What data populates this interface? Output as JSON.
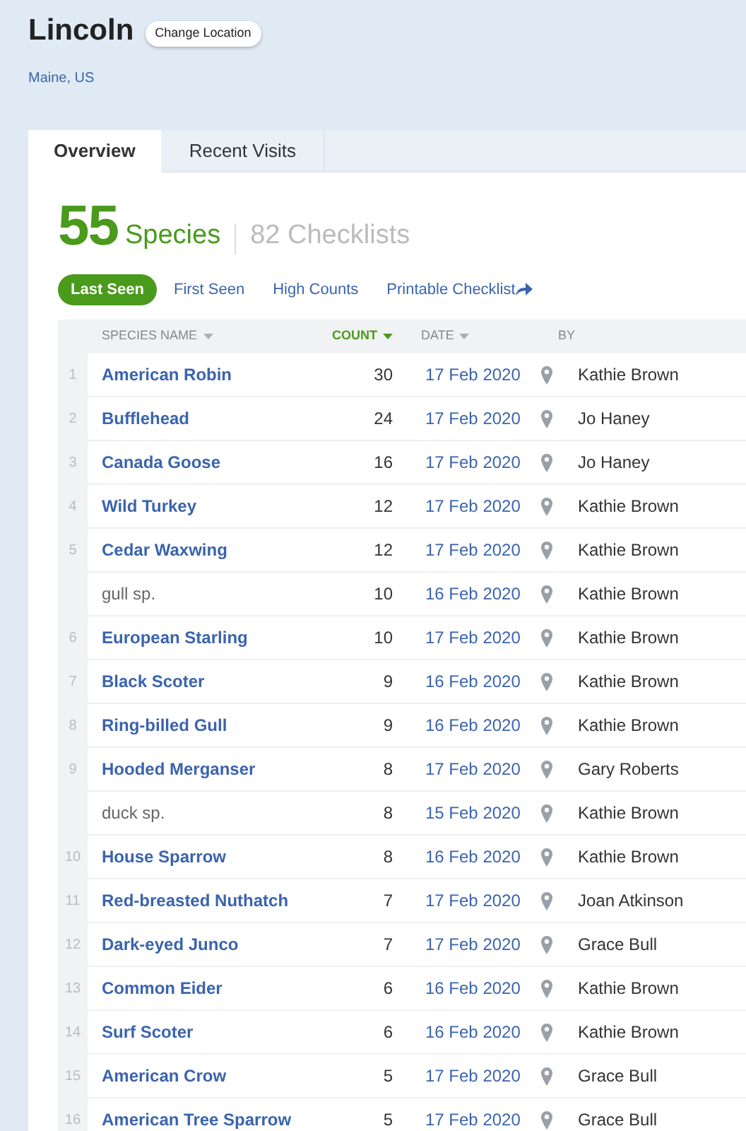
{
  "location": {
    "name": "Lincoln",
    "change_button": "Change Location",
    "region": "Maine, US"
  },
  "tabs": [
    {
      "label": "Overview",
      "selected": true
    },
    {
      "label": "Recent Visits",
      "selected": false
    }
  ],
  "summary": {
    "species_count": "55",
    "species_label": "Species",
    "checklists": "82 Checklists"
  },
  "filters": [
    {
      "label": "Last Seen",
      "selected": true,
      "external": false
    },
    {
      "label": "First Seen",
      "selected": false,
      "external": false
    },
    {
      "label": "High Counts",
      "selected": false,
      "external": false
    },
    {
      "label": "Printable Checklist",
      "selected": false,
      "external": true
    }
  ],
  "table": {
    "columns": [
      {
        "label": "SPECIES NAME",
        "sorted": false,
        "sortable": true
      },
      {
        "label": "COUNT",
        "sorted": true,
        "sortable": true
      },
      {
        "label": "DATE",
        "sorted": false,
        "sortable": true
      },
      {
        "label": "BY",
        "sorted": false,
        "sortable": false
      }
    ],
    "rows": [
      {
        "kind": "species",
        "number": "1",
        "name": "American Robin",
        "count": "30",
        "date": "17 Feb 2020",
        "by": "Kathie Brown"
      },
      {
        "kind": "species",
        "number": "2",
        "name": "Bufflehead",
        "count": "24",
        "date": "17 Feb 2020",
        "by": "Jo Haney"
      },
      {
        "kind": "species",
        "number": "3",
        "name": "Canada Goose",
        "count": "16",
        "date": "17 Feb 2020",
        "by": "Jo Haney"
      },
      {
        "kind": "species",
        "number": "4",
        "name": "Wild Turkey",
        "count": "12",
        "date": "17 Feb 2020",
        "by": "Kathie Brown"
      },
      {
        "kind": "species",
        "number": "5",
        "name": "Cedar Waxwing",
        "count": "12",
        "date": "17 Feb 2020",
        "by": "Kathie Brown"
      },
      {
        "kind": "spuh",
        "name": "gull sp.",
        "count": "10",
        "date": "16 Feb 2020",
        "by": "Kathie Brown"
      },
      {
        "kind": "species",
        "number": "6",
        "name": "European Starling",
        "count": "10",
        "date": "17 Feb 2020",
        "by": "Kathie Brown"
      },
      {
        "kind": "species",
        "number": "7",
        "name": "Black Scoter",
        "count": "9",
        "date": "16 Feb 2020",
        "by": "Kathie Brown"
      },
      {
        "kind": "species",
        "number": "8",
        "name": "Ring-billed Gull",
        "count": "9",
        "date": "16 Feb 2020",
        "by": "Kathie Brown"
      },
      {
        "kind": "species",
        "number": "9",
        "name": "Hooded Merganser",
        "count": "8",
        "date": "17 Feb 2020",
        "by": "Gary Roberts"
      },
      {
        "kind": "spuh",
        "name": "duck sp.",
        "count": "8",
        "date": "15 Feb 2020",
        "by": "Kathie Brown"
      },
      {
        "kind": "species",
        "number": "10",
        "name": "House Sparrow",
        "count": "8",
        "date": "16 Feb 2020",
        "by": "Kathie Brown"
      },
      {
        "kind": "species",
        "number": "11",
        "name": "Red-breasted Nuthatch",
        "count": "7",
        "date": "17 Feb 2020",
        "by": "Joan Atkinson"
      },
      {
        "kind": "species",
        "number": "12",
        "name": "Dark-eyed Junco",
        "count": "7",
        "date": "17 Feb 2020",
        "by": "Grace Bull"
      },
      {
        "kind": "species",
        "number": "13",
        "name": "Common Eider",
        "count": "6",
        "date": "16 Feb 2020",
        "by": "Kathie Brown"
      },
      {
        "kind": "species",
        "number": "14",
        "name": "Surf Scoter",
        "count": "6",
        "date": "16 Feb 2020",
        "by": "Kathie Brown"
      },
      {
        "kind": "species",
        "number": "15",
        "name": "American Crow",
        "count": "5",
        "date": "17 Feb 2020",
        "by": "Grace Bull"
      },
      {
        "kind": "species",
        "number": "16",
        "name": "American Tree Sparrow",
        "count": "5",
        "date": "17 Feb 2020",
        "by": "Grace Bull"
      }
    ]
  }
}
